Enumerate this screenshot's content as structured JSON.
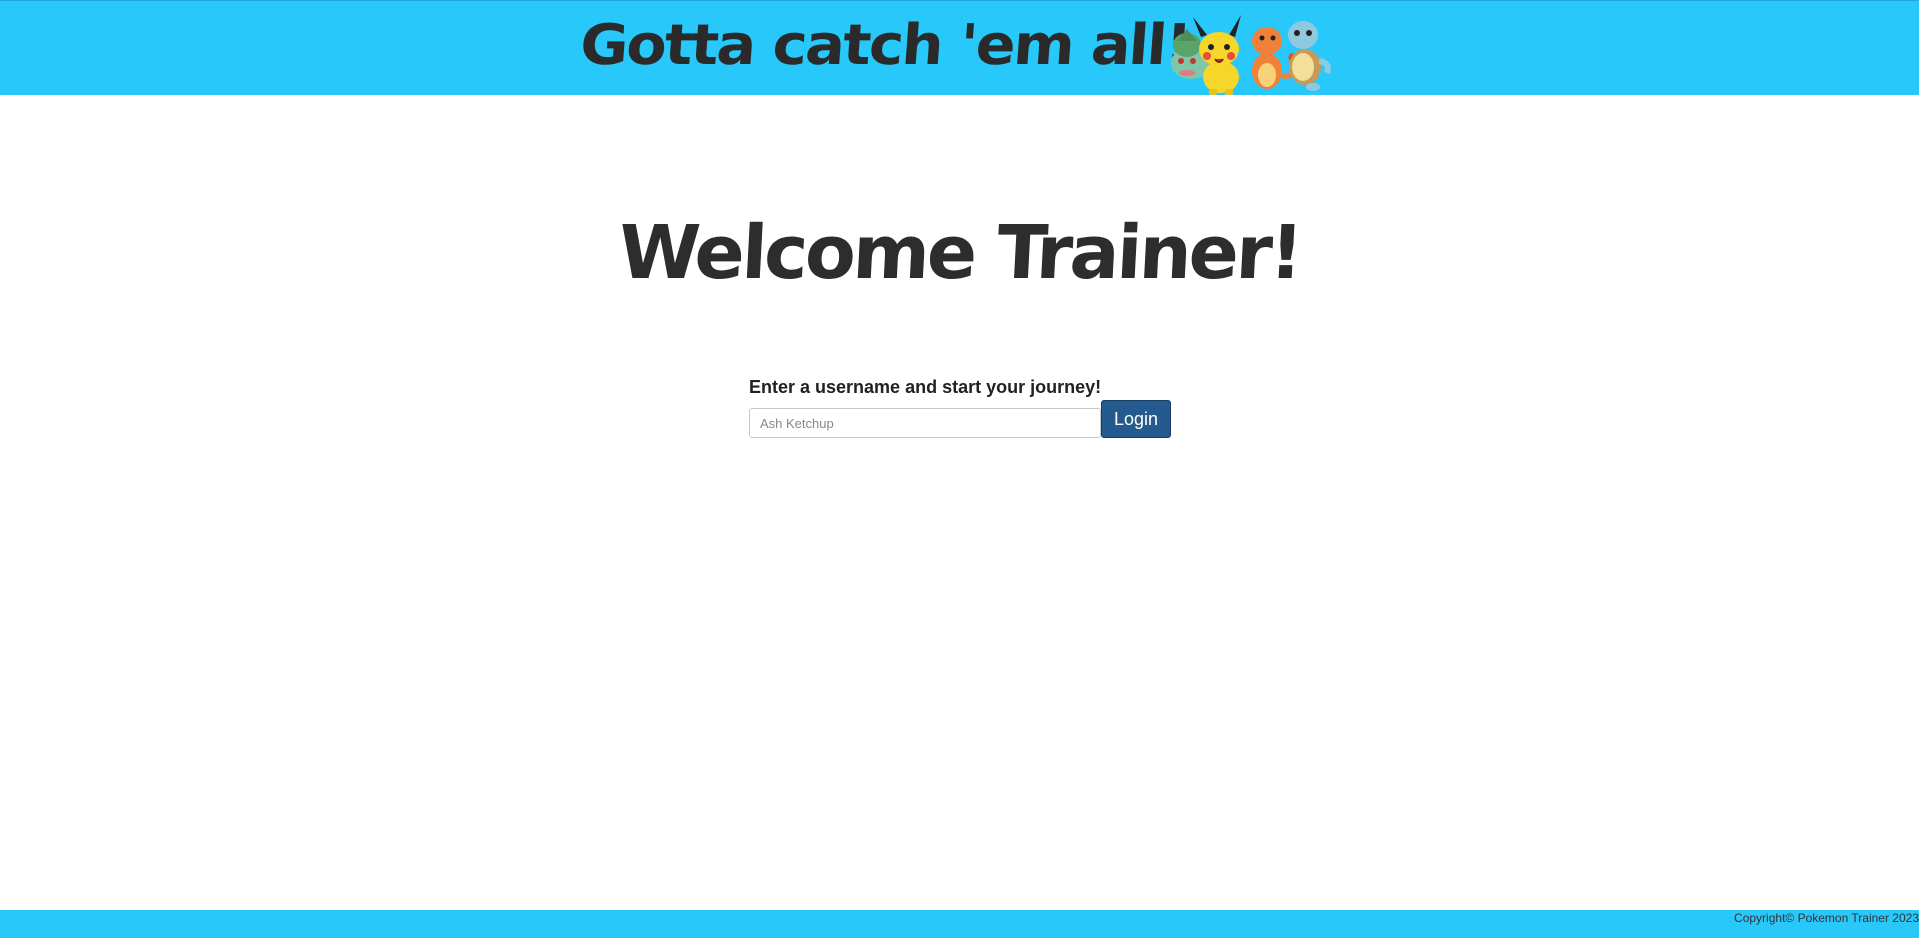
{
  "header": {
    "title": "Gotta catch 'em all!",
    "mascots_icon": "pokemon-starters-icon",
    "background_color": "#28c8fa"
  },
  "main": {
    "welcome": "Welcome Trainer!",
    "form": {
      "label": "Enter a username and start your journey!",
      "username_placeholder": "Ash Ketchup",
      "username_value": "",
      "login_label": "Login",
      "login_color": "#245a8d"
    }
  },
  "footer": {
    "text": "Copyright© Pokemon Trainer 2023",
    "background_color": "#28c8fa"
  }
}
